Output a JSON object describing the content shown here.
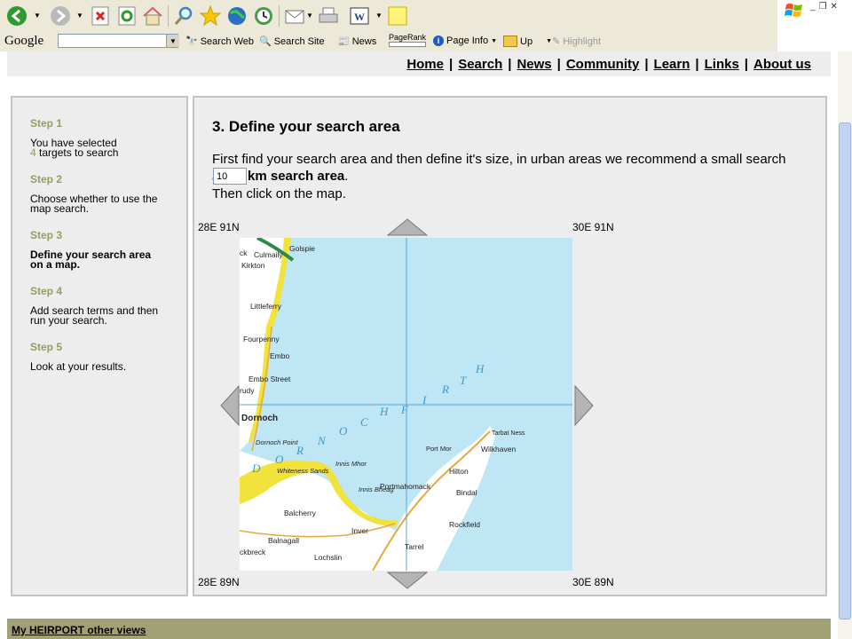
{
  "browser": {
    "google_bar": {
      "logo": "Google",
      "search_value": "",
      "search_web": "Search Web",
      "search_site": "Search Site",
      "news": "News",
      "pagerank": "PageRank",
      "page_info": "Page Info",
      "up": "Up",
      "highlight": "Highlight"
    }
  },
  "nav": {
    "links": [
      "Home",
      "Search",
      "News",
      "Community",
      "Learn",
      "Links",
      "About us"
    ],
    "separator": "|"
  },
  "steps": [
    {
      "title": "Step 1",
      "line1": "You have selected",
      "count": "4",
      "line2": "targets to search",
      "active": false
    },
    {
      "title": "Step 2",
      "text": "Choose whether to use the map search.",
      "active": false
    },
    {
      "title": "Step 3",
      "text": "Define your search area on a map.",
      "active": true
    },
    {
      "title": "Step 4",
      "text": "Add search terms and then run your search.",
      "active": false
    },
    {
      "title": "Step 5",
      "text": "Look at your results.",
      "active": false
    }
  ],
  "main": {
    "heading": "3. Define your search area",
    "instruction": "First find your search area and then define it's size, in urban areas we recommend a small search area",
    "km_value": "10",
    "km_label": "km search area",
    "km_suffix": ".",
    "click_text": "Then click on the map."
  },
  "map": {
    "corners": {
      "top_left": "28E 91N",
      "top_right": "30E 91N",
      "bottom_left": "28E 89N",
      "bottom_right": "30E 89N"
    },
    "places": [
      "Golspie",
      "Culmaily",
      "Kirkton",
      "Littleferry",
      "Fourpenny",
      "Embo",
      "Embo Street",
      "Dornoch",
      "Dornoch Point",
      "Whiteness Sands",
      "Innis Mhor",
      "Innis Bheag",
      "Portmahomack",
      "Port Mor",
      "Hilton",
      "Tarbat Ness",
      "Wilkhaven",
      "Bindal",
      "Rockfield",
      "Balcherry",
      "Inver",
      "Balnagall",
      "Lochslin",
      "Tarrel",
      "ckbreck",
      "rudy",
      "ck"
    ],
    "firth_label": [
      "D",
      "O",
      "R",
      "N",
      "O",
      "C",
      "H",
      "F",
      "I",
      "R",
      "T",
      "H"
    ],
    "colors": {
      "sea": "#bfe6f5",
      "land": "#ffffff",
      "sand": "#f2e23c",
      "road": "#e8a840",
      "grid": "#5aa6d8"
    }
  },
  "footer": {
    "link": "My HEIRPORT other views"
  }
}
